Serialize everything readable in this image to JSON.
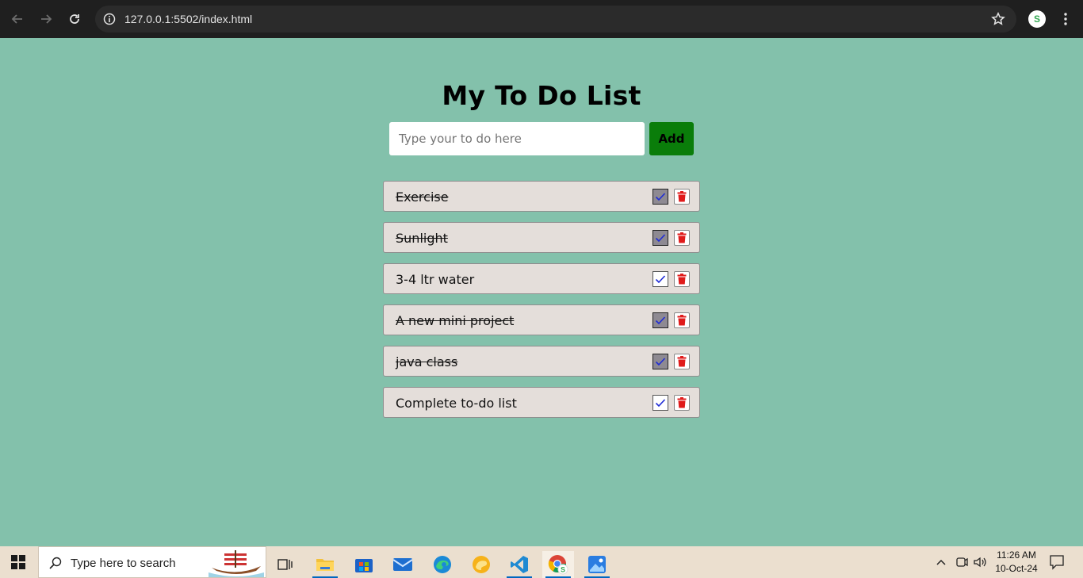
{
  "browser": {
    "url": "127.0.0.1:5502/index.html",
    "profile_initial": "S"
  },
  "page": {
    "title": "My To Do List",
    "input_placeholder": "Type your to do here",
    "input_value": "",
    "add_label": "Add",
    "items": [
      {
        "text": "Exercise",
        "done": true
      },
      {
        "text": "Sunlight",
        "done": true
      },
      {
        "text": "3-4 ltr water",
        "done": false
      },
      {
        "text": "A new mini project",
        "done": true
      },
      {
        "text": "java class",
        "done": true
      },
      {
        "text": "Complete to-do list",
        "done": false
      }
    ]
  },
  "taskbar": {
    "search_placeholder": "Type here to search",
    "time": "11:26 AM",
    "date": "10-Oct-24",
    "apps": [
      "task-view",
      "file-explorer",
      "microsoft-store",
      "mail",
      "edge",
      "edge-canary",
      "vs-code",
      "chrome",
      "photos"
    ]
  },
  "colors": {
    "page_bg": "#83c1ab",
    "item_bg": "#e4deda",
    "add_button": "#0a7d0a",
    "trash": "#e01b1b",
    "check": "#1f2bd6"
  }
}
